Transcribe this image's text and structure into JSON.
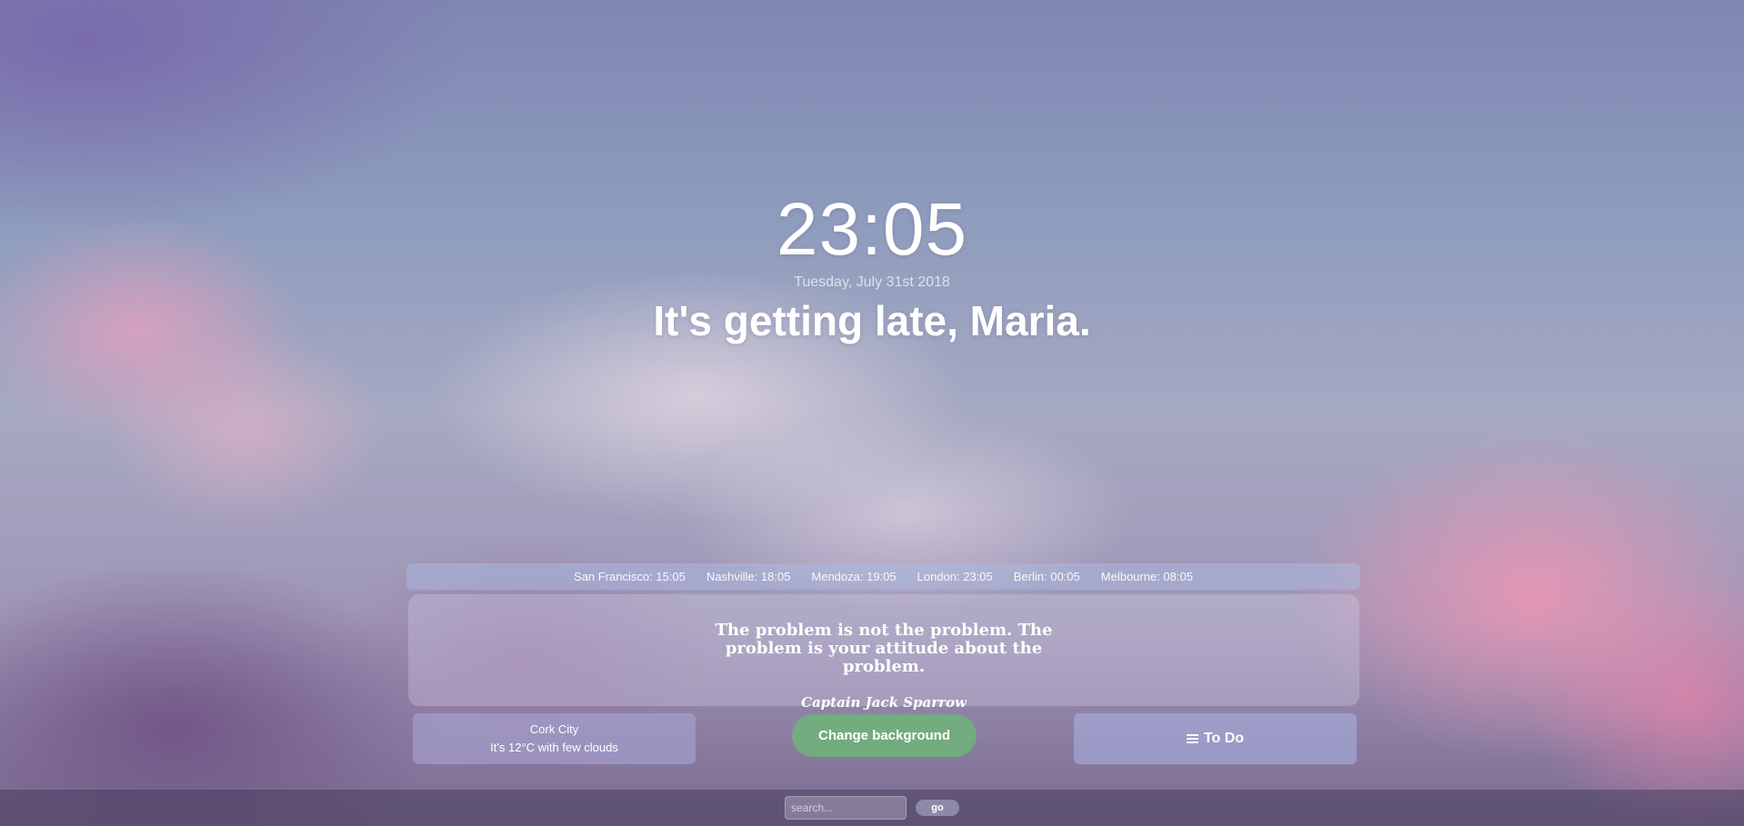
{
  "clock": {
    "time": "23:05",
    "date": "Tuesday, July 31st 2018",
    "greeting": "It's getting late, Maria."
  },
  "world_clocks": [
    {
      "label": "San Francisco: 15:05"
    },
    {
      "label": "Nashville: 18:05"
    },
    {
      "label": "Mendoza: 19:05"
    },
    {
      "label": "London: 23:05"
    },
    {
      "label": "Berlin: 00:05"
    },
    {
      "label": "Melbourne: 08:05"
    }
  ],
  "quote": {
    "text": "The problem is not the problem. The problem is your attitude about the problem.",
    "author": "Captain Jack Sparrow"
  },
  "weather": {
    "city": "Cork City",
    "summary": "It's 12°C with few clouds"
  },
  "actions": {
    "change_background_label": "Change background",
    "todo_label": "To Do",
    "todo_icon": "hamburger-menu-icon"
  },
  "search": {
    "placeholder": "search...",
    "value": "",
    "go_label": "go"
  },
  "colors": {
    "change_background_button": "#6eb478",
    "text": "#ffffff"
  }
}
